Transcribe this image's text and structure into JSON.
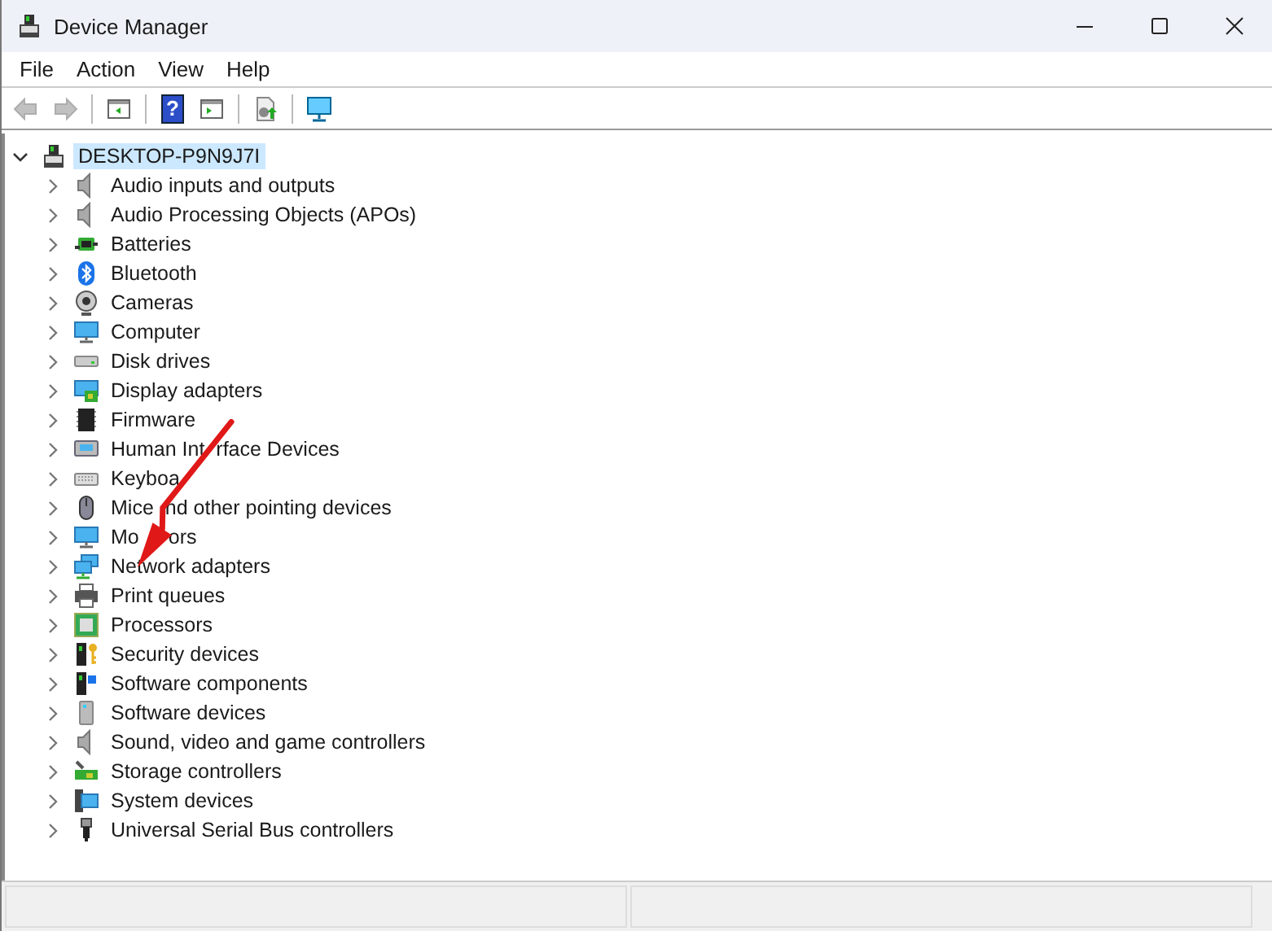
{
  "window": {
    "title": "Device Manager"
  },
  "menu": [
    {
      "label": "File"
    },
    {
      "label": "Action"
    },
    {
      "label": "View"
    },
    {
      "label": "Help"
    }
  ],
  "toolbar": [
    {
      "kind": "back",
      "disabled": true
    },
    {
      "kind": "forward",
      "disabled": true
    },
    {
      "kind": "separator"
    },
    {
      "kind": "properties"
    },
    {
      "kind": "separator"
    },
    {
      "kind": "help",
      "glyph": "?"
    },
    {
      "kind": "update"
    },
    {
      "kind": "separator"
    },
    {
      "kind": "driver"
    },
    {
      "kind": "separator"
    },
    {
      "kind": "scan"
    }
  ],
  "tree": [
    {
      "label": "DESKTOP-P9N9J7I",
      "expanded": true,
      "selected": true,
      "children": [
        {
          "label": "Audio inputs and outputs",
          "expanded": false,
          "selected": false
        },
        {
          "label": "Audio Processing Objects (APOs)",
          "expanded": false,
          "selected": false
        },
        {
          "label": "Batteries",
          "expanded": false,
          "selected": false
        },
        {
          "label": "Bluetooth",
          "expanded": false,
          "selected": false
        },
        {
          "label": "Cameras",
          "expanded": false,
          "selected": false
        },
        {
          "label": "Computer",
          "expanded": false,
          "selected": false
        },
        {
          "label": "Disk drives",
          "expanded": false,
          "selected": false
        },
        {
          "label": "Display adapters",
          "expanded": false,
          "selected": false
        },
        {
          "label": "Firmware",
          "expanded": false,
          "selected": false
        },
        {
          "parts": [
            "Human Int",
            "rface Devices"
          ],
          "expanded": false,
          "selected": false
        },
        {
          "parts": [
            "Keyboa"
          ],
          "expanded": false,
          "selected": false
        },
        {
          "parts": [
            "Mice",
            "nd other pointing devices"
          ],
          "expanded": false,
          "selected": false
        },
        {
          "parts": [
            "Mo",
            "ors"
          ],
          "expanded": false,
          "selected": false
        },
        {
          "label": "Network adapters",
          "expanded": false,
          "selected": false
        },
        {
          "label": "Print queues",
          "expanded": false,
          "selected": false
        },
        {
          "label": "Processors",
          "expanded": false,
          "selected": false
        },
        {
          "label": "Security devices",
          "expanded": false,
          "selected": false
        },
        {
          "label": "Software components",
          "expanded": false,
          "selected": false
        },
        {
          "label": "Software devices",
          "expanded": false,
          "selected": false
        },
        {
          "label": "Sound, video and game controllers",
          "expanded": false,
          "selected": false
        },
        {
          "label": "Storage controllers",
          "expanded": false,
          "selected": false
        },
        {
          "label": "System devices",
          "expanded": false,
          "selected": false
        },
        {
          "label": "Universal Serial Bus controllers",
          "expanded": false,
          "selected": false
        }
      ]
    }
  ],
  "annotation": {
    "kind": "arrow"
  }
}
